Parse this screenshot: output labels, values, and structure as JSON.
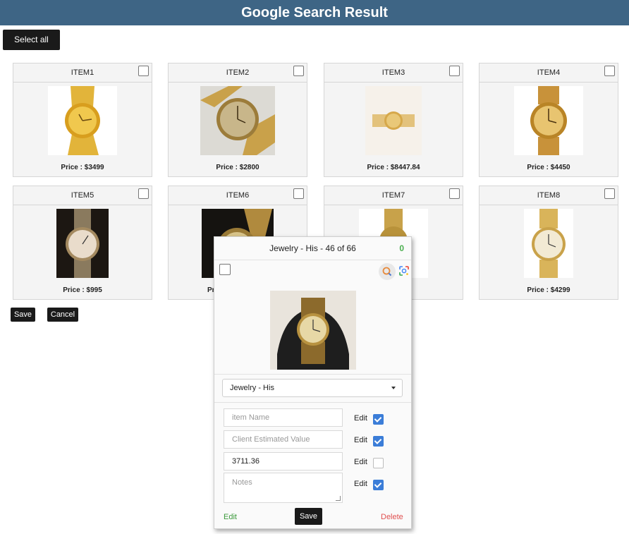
{
  "header": {
    "title": "Google Search Result"
  },
  "toolbar": {
    "select_all_label": "Select all"
  },
  "items": [
    {
      "label": "ITEM1",
      "price": "Price : $3499"
    },
    {
      "label": "ITEM2",
      "price": "Price : $2800"
    },
    {
      "label": "ITEM3",
      "price": "Price : $8447.84"
    },
    {
      "label": "ITEM4",
      "price": "Price : $4450"
    },
    {
      "label": "ITEM5",
      "price": "Price : $995"
    },
    {
      "label": "ITEM6",
      "price": "Pri"
    },
    {
      "label": "ITEM7",
      "price": ""
    },
    {
      "label": "ITEM8",
      "price": "Price : $4299"
    }
  ],
  "actions": {
    "save_label": "Save",
    "cancel_label": "Cancel"
  },
  "modal": {
    "title": "Jewelry - His - 46 of 66",
    "count": "0",
    "category_value": "Jewelry - His",
    "fields": {
      "item_name_placeholder": "item Name",
      "client_value_placeholder": "Client Estimated Value",
      "value": "3711.36",
      "notes_placeholder": "Notes"
    },
    "edit_label": "Edit",
    "edit_checked": [
      true,
      true,
      false,
      true
    ],
    "footer": {
      "edit_label": "Edit",
      "save_label": "Save",
      "delete_label": "Delete"
    }
  },
  "colors": {
    "header_bg": "#3e6585",
    "checkbox_on": "#3b7dd8",
    "edit_link": "#3c9a3c",
    "delete_link": "#e05050",
    "count_green": "#4caf50"
  }
}
